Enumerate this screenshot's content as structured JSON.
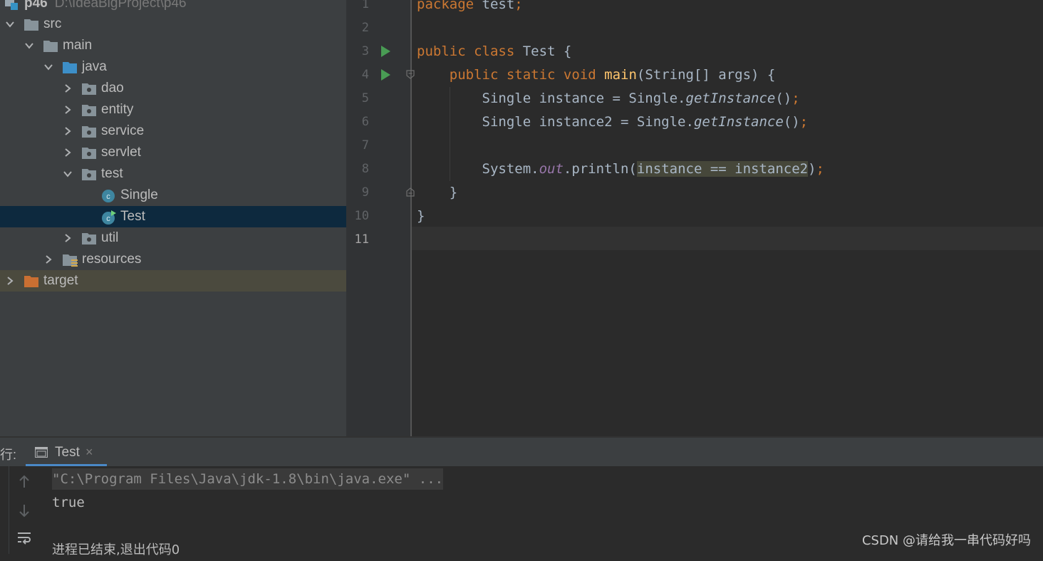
{
  "project": {
    "name": "p46",
    "path": "D:\\IdeaBigProject\\p46",
    "tree": [
      {
        "label": "src"
      },
      {
        "label": "main"
      },
      {
        "label": "java"
      },
      {
        "label": "dao"
      },
      {
        "label": "entity"
      },
      {
        "label": "service"
      },
      {
        "label": "servlet"
      },
      {
        "label": "test"
      },
      {
        "label": "Single"
      },
      {
        "label": "Test"
      },
      {
        "label": "util"
      },
      {
        "label": "resources"
      },
      {
        "label": "target"
      }
    ]
  },
  "editor": {
    "line_numbers": [
      "1",
      "2",
      "3",
      "4",
      "5",
      "6",
      "7",
      "8",
      "9",
      "10",
      "11"
    ],
    "current_line": "11",
    "code": {
      "l1_kw": "package",
      "l1_rest": " test",
      "l1_semi": ";",
      "l3_kw": "public class",
      "l3_rest": " Test {",
      "l4_kw": "public static void",
      "l4_fn": "main",
      "l4_rest": "(String[] args) {",
      "l5_a": "Single instance = Single.",
      "l5_call": "getInstance",
      "l5_b": "()",
      "l5_semi": ";",
      "l6_a": "Single instance2 = Single.",
      "l6_call": "getInstance",
      "l6_b": "()",
      "l6_semi": ";",
      "l8_a": "System.",
      "l8_out": "out",
      "l8_b": ".println(",
      "l8_hl": "instance == instance2",
      "l8_c": ")",
      "l8_semi": ";",
      "l9": "}",
      "l10": "}"
    }
  },
  "run_panel": {
    "title": "行:",
    "tab_label": "Test",
    "tab_close": "×",
    "command": "\"C:\\Program Files\\Java\\jdk-1.8\\bin\\java.exe\" ...",
    "result": "true",
    "exit_message": "进程已结束,退出代码0"
  },
  "watermark": "CSDN @请给我一串代码好吗",
  "colors": {
    "keyword": "#cc7832",
    "method": "#ffc66d",
    "static_field": "#9876aa",
    "selection": "#0d293e",
    "run_icon": "#499c54",
    "folder_blue": "#4a88c7",
    "folder_orange": "#c96f32"
  }
}
